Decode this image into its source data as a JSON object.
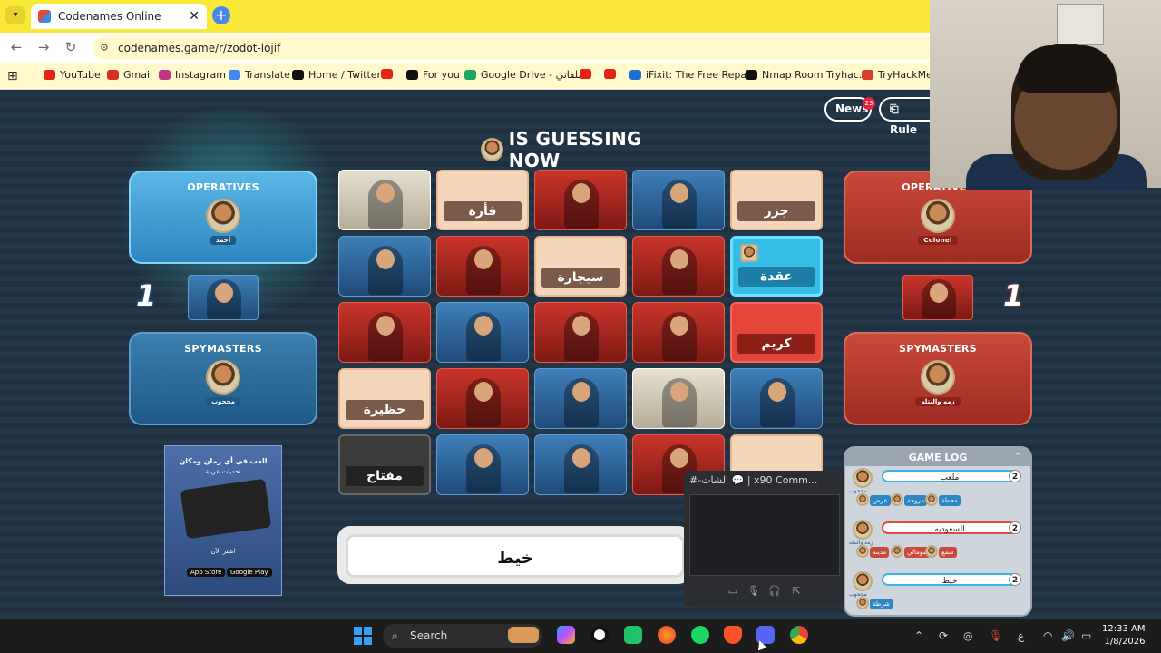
{
  "browser": {
    "tab_title": "Codenames Online",
    "tab_close": "✕",
    "new_tab": "+",
    "url": "codenames.game/r/zodot-lojif",
    "bookmarks": [
      {
        "label": "YouTube",
        "color": "#e62117"
      },
      {
        "label": "Gmail",
        "color": "#d93025"
      },
      {
        "label": "Instagram",
        "color": "#c13584"
      },
      {
        "label": "Translate",
        "color": "#4285f4"
      },
      {
        "label": "Home / Twitter",
        "color": "#111111"
      },
      {
        "label": "",
        "color": "#e62117"
      },
      {
        "label": "For you",
        "color": "#111111"
      },
      {
        "label": "Google Drive - ملفاتي",
        "color": "#1fa463"
      },
      {
        "label": "",
        "color": "#e62117"
      },
      {
        "label": "",
        "color": "#e62117"
      },
      {
        "label": "iFixit: The Free Repa...",
        "color": "#1d6fd6"
      },
      {
        "label": "Nmap Room Tryhac...",
        "color": "#111111"
      },
      {
        "label": "TryHackMe | ",
        "color": "#d63d2a"
      }
    ]
  },
  "header": {
    "news_label": "News",
    "news_count": "23",
    "rules_label": "Rule"
  },
  "status": {
    "guessing_text": "IS GUESSING NOW"
  },
  "blue_team": {
    "operatives_title": "OPERATIVES",
    "operative_name": "أحمد",
    "score": "1",
    "spymasters_title": "SPYMASTERS",
    "spymaster_name": "مجحوب"
  },
  "red_team": {
    "operatives_title": "OPERATIVES",
    "operative_name": "Colonel",
    "score": "1",
    "spymasters_title": "SPYMASTERS",
    "spymaster_name": "زمه والبتله"
  },
  "board": [
    {
      "type": "pic-white",
      "word": ""
    },
    {
      "type": "beige",
      "word": "فأرة"
    },
    {
      "type": "pic-red",
      "word": ""
    },
    {
      "type": "pic-blue",
      "word": ""
    },
    {
      "type": "beige",
      "word": "جزر"
    },
    {
      "type": "pic-blue",
      "word": ""
    },
    {
      "type": "pic-red",
      "word": ""
    },
    {
      "type": "beige",
      "word": "سيجارة"
    },
    {
      "type": "pic-red",
      "word": ""
    },
    {
      "type": "blue",
      "word": "عقدة"
    },
    {
      "type": "pic-red",
      "word": ""
    },
    {
      "type": "pic-blue",
      "word": ""
    },
    {
      "type": "pic-red",
      "word": ""
    },
    {
      "type": "pic-red",
      "word": ""
    },
    {
      "type": "red",
      "word": "كريم"
    },
    {
      "type": "beige",
      "word": "حظيرة"
    },
    {
      "type": "pic-red",
      "word": ""
    },
    {
      "type": "pic-blue",
      "word": ""
    },
    {
      "type": "pic-white",
      "word": ""
    },
    {
      "type": "pic-blue",
      "word": ""
    },
    {
      "type": "grey",
      "word": "مفتاح"
    },
    {
      "type": "pic-blue",
      "word": ""
    },
    {
      "type": "pic-blue",
      "word": ""
    },
    {
      "type": "pic-red",
      "word": ""
    },
    {
      "type": "beige",
      "word": ""
    }
  ],
  "clue": {
    "word": "خيط"
  },
  "ad": {
    "line1": "العب في أي زمان ومكان",
    "line2": "تحديات عربية",
    "cta": "اشتر الآن",
    "store1": "App Store",
    "store2": "Google Play"
  },
  "discord": {
    "title": "#-الشات 💬 | x90 Comm...",
    "ctl_video": "▭",
    "ctl_mic": "🎙",
    "ctl_head": "🎧",
    "ctl_share": "⇱"
  },
  "game_log": {
    "title": "GAME LOG",
    "entries": [
      {
        "clue": "ملعب",
        "count": "2",
        "team": "blue",
        "player": "مجحوب",
        "guesses": [
          "عرض",
          "مروحة",
          "محطة"
        ]
      },
      {
        "clue": "السعوديه",
        "count": "2",
        "team": "red",
        "player": "زمه والبتله",
        "guesses": [
          "مدينة",
          "صومالي",
          "شمع"
        ]
      },
      {
        "clue": "خيط",
        "count": "2",
        "team": "blue",
        "player": "مجحوب",
        "guesses": [
          "شرطة"
        ]
      }
    ]
  },
  "taskbar": {
    "search_label": "Search",
    "time": "12:33 AM",
    "date": "1/8/2026",
    "lang": "ع"
  }
}
